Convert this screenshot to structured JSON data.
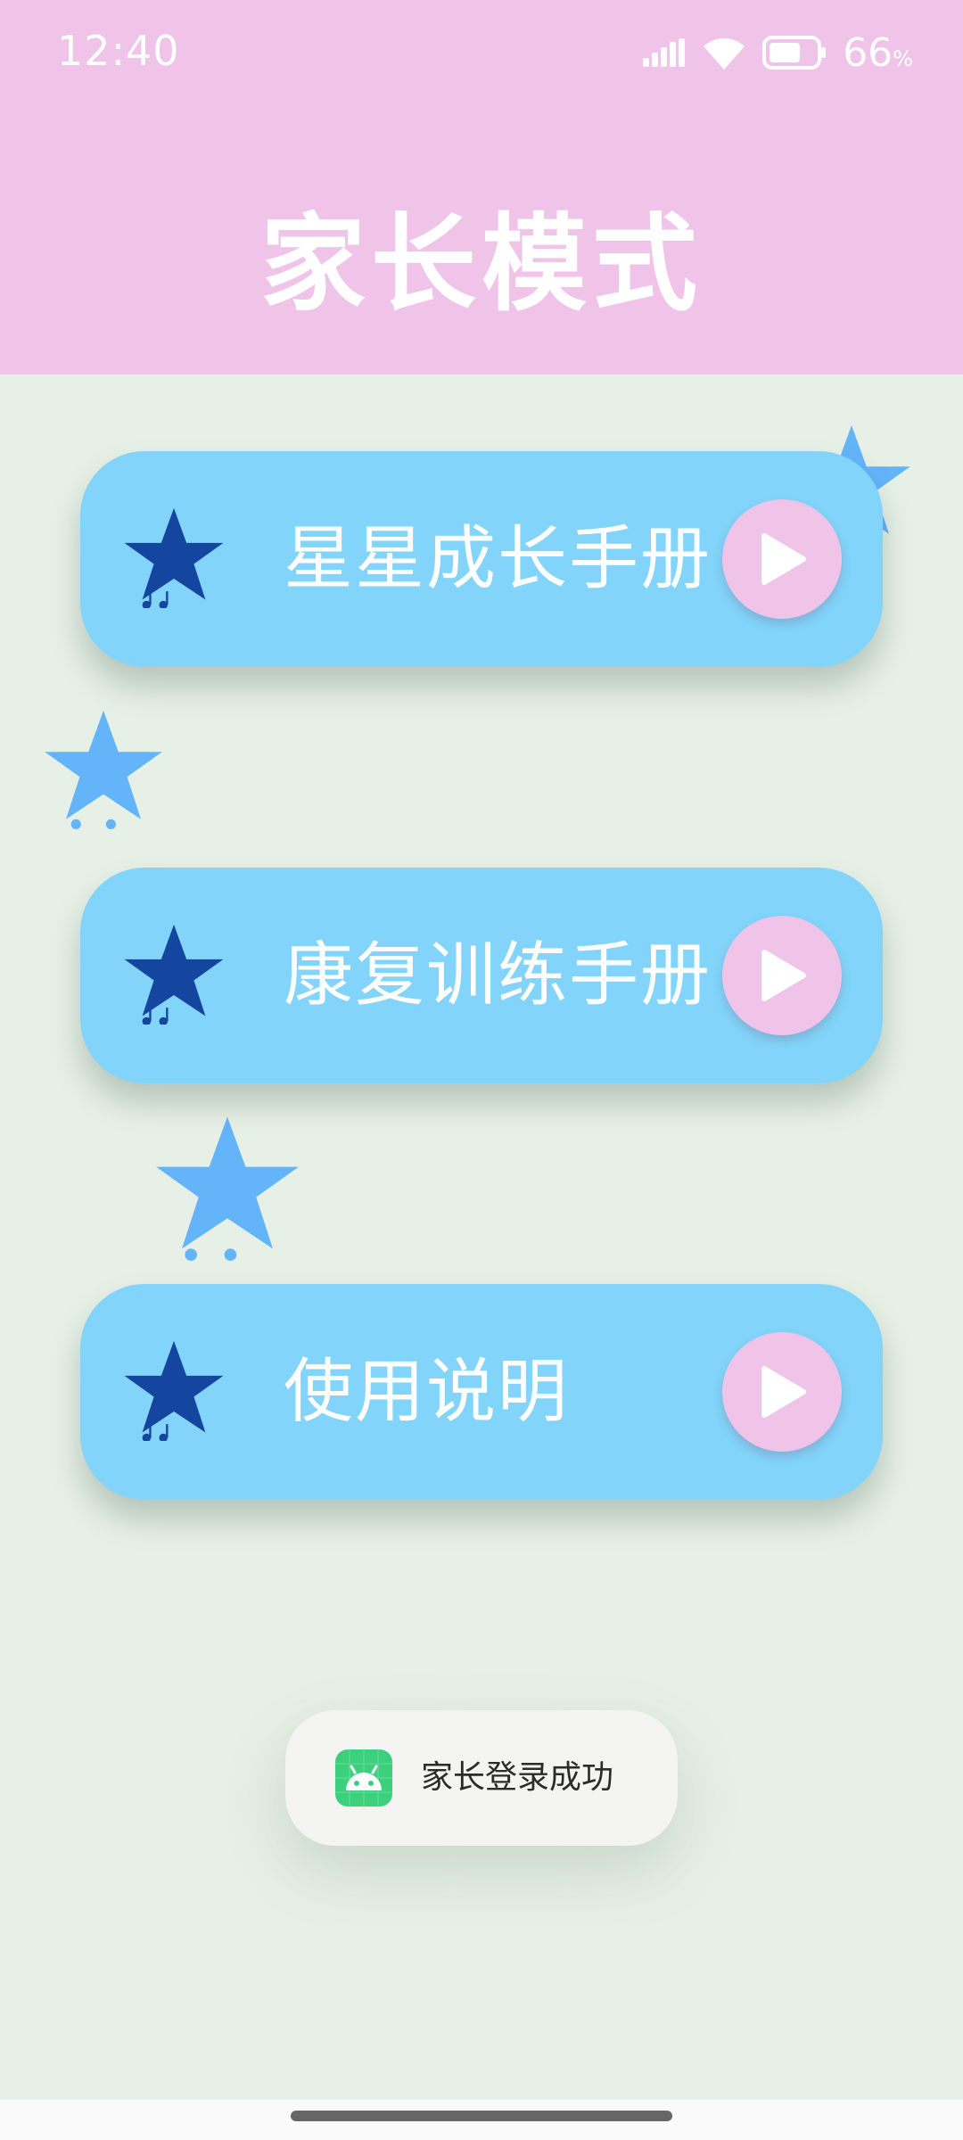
{
  "status_bar": {
    "time": "12:40",
    "battery_level": "66",
    "battery_unit": "%",
    "icons": [
      "signal-icon",
      "wifi-icon",
      "battery-icon"
    ]
  },
  "header": {
    "title": "家长模式",
    "background": "#f0c4e8"
  },
  "menu": {
    "items": [
      {
        "label": "星星成长手册",
        "icon": "star-music-icon",
        "action_icon": "play-icon"
      },
      {
        "label": "康复训练手册",
        "icon": "star-music-icon",
        "action_icon": "play-icon"
      },
      {
        "label": "使用说明",
        "icon": "star-music-icon",
        "action_icon": "play-icon"
      }
    ],
    "button_color": "#82d4fa",
    "play_color": "#f0c4e8"
  },
  "toast": {
    "app_icon": "android-icon",
    "message": "家长登录成功"
  },
  "colors": {
    "background": "#e6f0e6",
    "star_dark": "#1446a0",
    "star_light": "#64b4fa"
  }
}
